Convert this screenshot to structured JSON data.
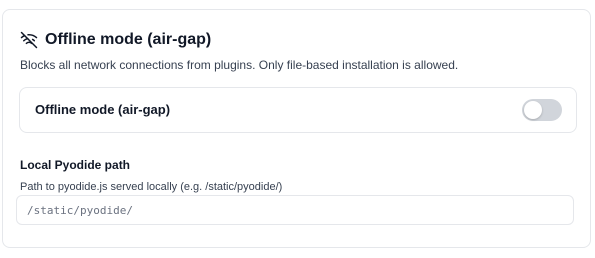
{
  "section": {
    "icon": "wifi-off-icon",
    "title": "Offline mode (air-gap)",
    "description": "Blocks all network connections from plugins. Only file-based installation is allowed."
  },
  "offline_toggle": {
    "label": "Offline mode (air-gap)",
    "enabled": false
  },
  "pyodide_path": {
    "label": "Local Pyodide path",
    "help": "Path to pyodide.js served locally (e.g. /static/pyodide/)",
    "value": "",
    "placeholder": "/static/pyodide/"
  },
  "colors": {
    "switch_off": "#d1d5db",
    "border": "#e5e7eb"
  }
}
